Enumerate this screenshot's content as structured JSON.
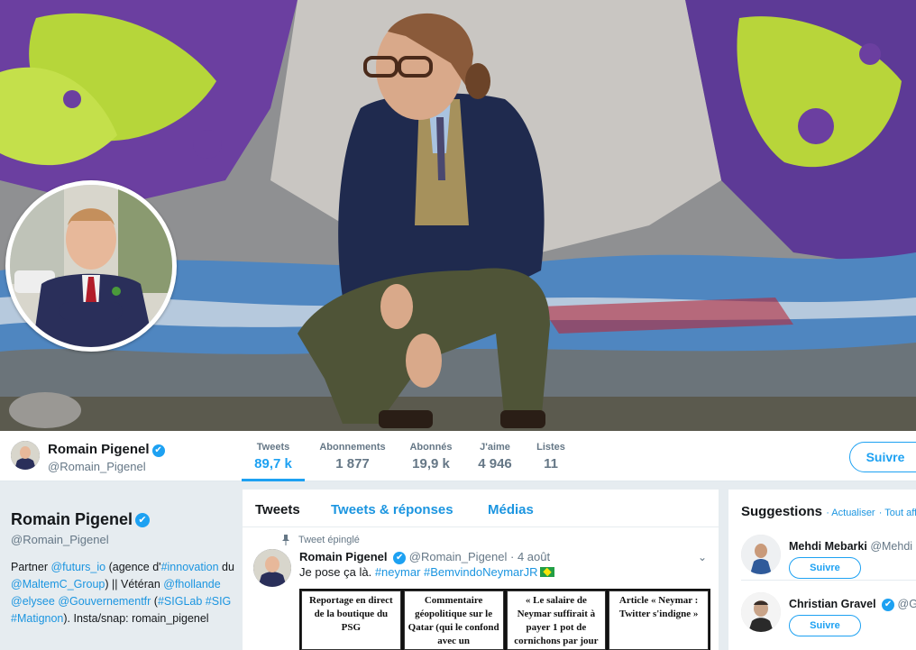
{
  "profile": {
    "name": "Romain Pigenel",
    "handle": "@Romain_Pigenel",
    "verified_glyph": "✔"
  },
  "nav": {
    "stats": [
      {
        "label": "Tweets",
        "value": "89,7 k",
        "active": true
      },
      {
        "label": "Abonnements",
        "value": "1 877"
      },
      {
        "label": "Abonnés",
        "value": "19,9 k"
      },
      {
        "label": "J'aime",
        "value": "4 946"
      },
      {
        "label": "Listes",
        "value": "11"
      }
    ],
    "follow_label": "Suivre"
  },
  "bio": {
    "name": "Romain Pigenel",
    "handle": "@Romain_Pigenel",
    "parts": {
      "p1": "Partner ",
      "l1": "@futurs_io",
      "p2": " (agence d'",
      "l2": "#innovation",
      "p3": " du ",
      "l3": "@MaltemC_Group",
      "p4": ") || Vétéran ",
      "l4": "@fhollande",
      "p5": " ",
      "l5": "@elysee",
      "p6": " ",
      "l6": "@Gouvernementfr",
      "p7": " (",
      "l7": "#SIGLab",
      "p8": " ",
      "l8": "#SIG",
      "p9": " ",
      "l9": "#Matignon",
      "p10": "). Insta/snap: romain_pigenel"
    }
  },
  "timeline": {
    "tabs": [
      "Tweets",
      "Tweets & réponses",
      "Médias"
    ],
    "pinned_label": "Tweet épinglé",
    "tweet": {
      "name": "Romain Pigenel",
      "handle": "@Romain_Pigenel",
      "separator": "·",
      "date": "4 août",
      "text": "Je pose ça là. ",
      "hashtag1": "#neymar",
      "hashtag2": "#BemvindoNeymarJR",
      "caret": "⌄"
    },
    "media_panels": [
      "Reportage en direct de la boutique du PSG",
      "Commentaire géopolitique sur le Qatar (qui le confond avec un",
      "« Le salaire de Neymar suffirait à payer 1 pot de cornichons par jour",
      "Article « Neymar : Twitter s'indigne »"
    ]
  },
  "suggestions": {
    "title": "Suggestions",
    "refresh": "· Actualiser",
    "all": "· Tout aff",
    "items": [
      {
        "name": "Mehdi Mebarki",
        "handle": "@Mehdi",
        "button": "Suivre"
      },
      {
        "name": "Christian Gravel",
        "handle": "@Gra",
        "button": "Suivre"
      }
    ]
  }
}
